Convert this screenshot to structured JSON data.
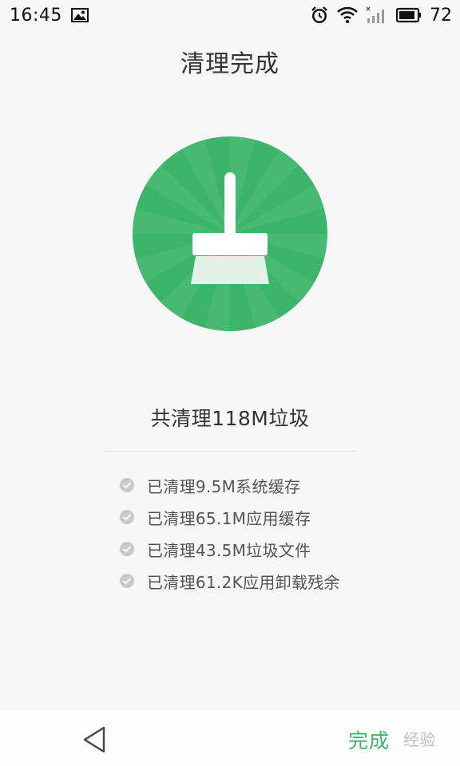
{
  "status_bar": {
    "time": "16:45",
    "battery": "72",
    "icons": [
      "image-icon",
      "alarm-icon",
      "wifi-icon",
      "signal-icon",
      "battery-icon"
    ]
  },
  "header": {
    "title": "清理完成"
  },
  "hero": {
    "icon": "broom-icon",
    "color": "#3cb56b"
  },
  "summary": {
    "text": "共清理118M垃圾"
  },
  "details": [
    {
      "text": "已清理9.5M系统缓存"
    },
    {
      "text": "已清理65.1M应用缓存"
    },
    {
      "text": "已清理43.5M垃圾文件"
    },
    {
      "text": "已清理61.2K应用卸载残余"
    }
  ],
  "bottom_bar": {
    "back_icon": "back-triangle-icon",
    "done_label": "完成",
    "watermark": "经验"
  },
  "colors": {
    "accent": "#3cb56b",
    "background": "#f7f7f7"
  }
}
